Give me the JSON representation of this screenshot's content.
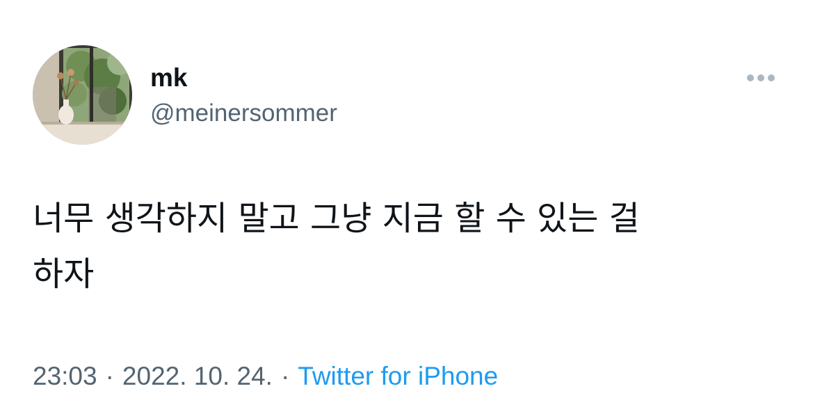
{
  "user": {
    "display_name": "mk",
    "handle": "@meinersommer"
  },
  "tweet": {
    "line1": "너무 생각하지 말고 그냥 지금 할 수 있는 걸",
    "line2": "하자"
  },
  "meta": {
    "time": "23:03",
    "separator": "·",
    "date": "2022. 10. 24.",
    "source": "Twitter for iPhone"
  },
  "colors": {
    "text": "#0f1419",
    "secondary": "#536471",
    "link": "#1d9bf0",
    "more_icon": "#aab8c2"
  },
  "icons": {
    "more": "more-horizontal-icon"
  }
}
